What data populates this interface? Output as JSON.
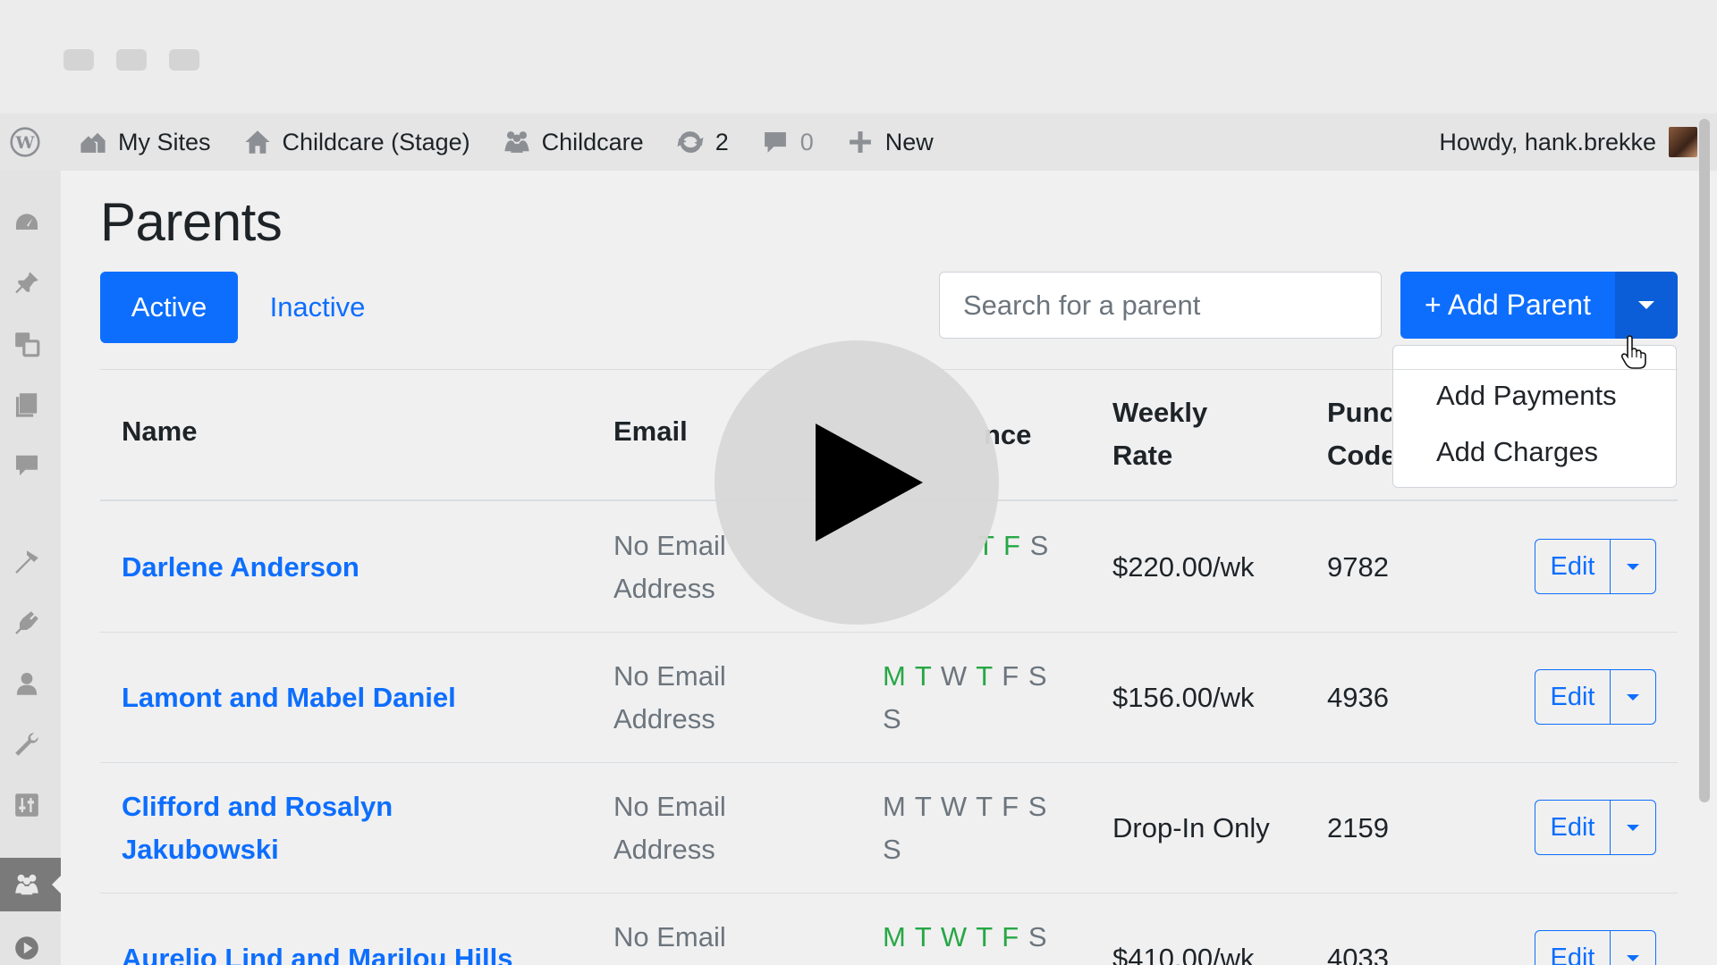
{
  "adminbar": {
    "my_sites": "My Sites",
    "site_name": "Childcare (Stage)",
    "plugin": "Childcare",
    "updates_count": "2",
    "comments_count": "0",
    "new_label": "New",
    "howdy": "Howdy, hank.brekke"
  },
  "page": {
    "title": "Parents",
    "tab_active": "Active",
    "tab_inactive": "Inactive"
  },
  "search": {
    "placeholder": "Search for a parent"
  },
  "add_button": {
    "label": "+ Add Parent"
  },
  "dropdown": {
    "items": [
      "Add Payments",
      "Add Charges"
    ]
  },
  "table": {
    "headers": {
      "name": "Name",
      "email": "Email",
      "attendance_partial": "nce",
      "weekly_rate_line1": "Weekly",
      "weekly_rate_line2": "Rate",
      "punch_code_line1": "Punc",
      "punch_code_line2": "Code"
    },
    "edit_label": "Edit",
    "rows": [
      {
        "name": "Darlene Anderson",
        "email_line1": "No Email",
        "email_line2": "Address",
        "days_line1": "T F S",
        "days_line2": "",
        "rate": "$220.00/wk",
        "code": "9782"
      },
      {
        "name": "Lamont and Mabel Daniel",
        "email_line1": "No Email",
        "email_line2": "Address",
        "days_line1": "M T W T F S",
        "days_line2": "S",
        "rate": "$156.00/wk",
        "code": "4936"
      },
      {
        "name": "Clifford and Rosalyn Jakubowski",
        "email_line1": "No Email",
        "email_line2": "Address",
        "days_line1": "M T W T F S",
        "days_line2": "S",
        "rate": "Drop-In Only",
        "code": "2159"
      },
      {
        "name": "Aurelio Lind and Marilou Hills",
        "email_line1": "No Email",
        "email_line2": "",
        "days_line1": "M T W T F S",
        "days_line2": "",
        "rate": "$410.00/wk",
        "code": "4033"
      }
    ]
  },
  "colors": {
    "primary": "#0d6efd",
    "active_day": "#28a745",
    "inactive_day": "#6c757d"
  },
  "icons": [
    "wordpress-icon",
    "my-sites-icon",
    "home-icon",
    "groups-icon",
    "updates-icon",
    "comments-icon",
    "plus-icon",
    "play-icon"
  ]
}
